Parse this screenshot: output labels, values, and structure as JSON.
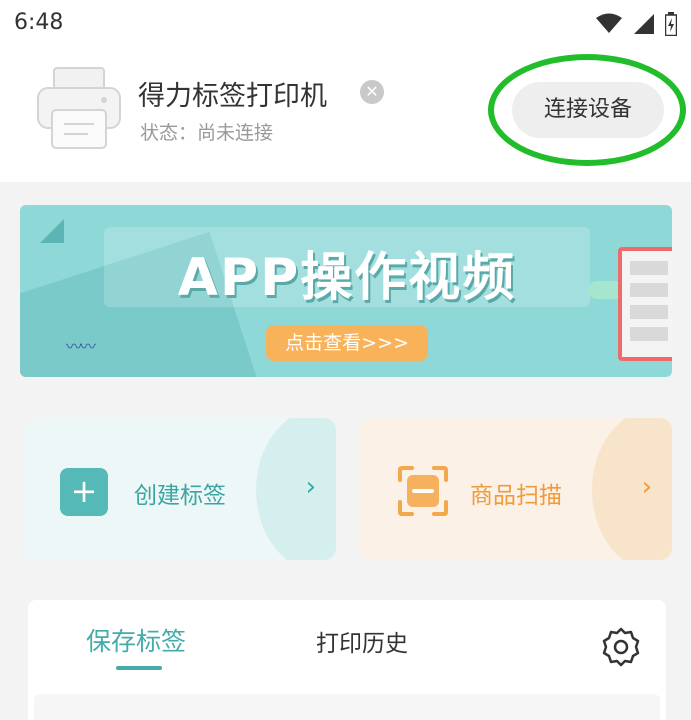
{
  "status_bar": {
    "time": "6:48",
    "icons": [
      "wifi-icon",
      "signal-icon",
      "battery-icon"
    ]
  },
  "header": {
    "device_name": "得力标签打印机",
    "status": "状态：尚未连接",
    "connect_label": "连接设备",
    "icons": [
      "printer-icon",
      "clear-icon"
    ],
    "highlight_color": "#22bd2a"
  },
  "banner": {
    "title": "APP操作视频",
    "cta": "点击查看>>>",
    "colors": {
      "background": "#8fd8d8",
      "cta": "#f8b35a"
    }
  },
  "cards": {
    "create": {
      "label": "创建标签",
      "icon": "plus-icon",
      "accent": "#3aa6a4"
    },
    "scan": {
      "label": "商品扫描",
      "icon": "scan-icon",
      "accent": "#f19a3a"
    }
  },
  "tabs": {
    "saved": "保存标签",
    "history": "打印历史",
    "active": "saved",
    "settings_icon": "gear-icon",
    "accent": "#43aca9"
  }
}
